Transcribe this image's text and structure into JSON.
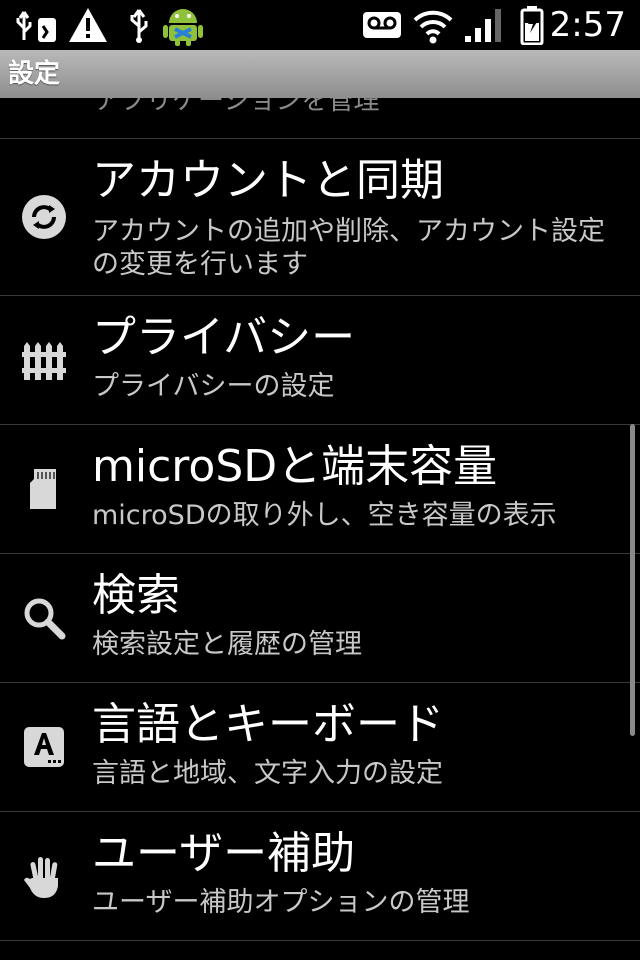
{
  "status_bar": {
    "icons": [
      "usb-debug-icon",
      "warning-icon",
      "usb-icon",
      "android-icon",
      "voicemail-icon",
      "wifi-icon",
      "signal-icon",
      "battery-charging-icon"
    ],
    "time": "2:57"
  },
  "title_bar": {
    "title": "設定"
  },
  "list": {
    "partial_item": "アプリケーションを管理",
    "items": [
      {
        "title": "アカウントと同期",
        "subtitle": "アカウントの追加や削除、アカウント設定の変更を行います",
        "icon": "sync-icon"
      },
      {
        "title": "プライバシー",
        "subtitle": "プライバシーの設定",
        "icon": "fence-icon"
      },
      {
        "title": "microSDと端末容量",
        "subtitle": "microSDの取り外し、空き容量の表示",
        "icon": "sd-card-icon"
      },
      {
        "title": "検索",
        "subtitle": "検索設定と履歴の管理",
        "icon": "search-icon"
      },
      {
        "title": "言語とキーボード",
        "subtitle": "言語と地域、文字入力の設定",
        "icon": "keyboard-language-icon"
      },
      {
        "title": "ユーザー補助",
        "subtitle": "ユーザー補助オプションの管理",
        "icon": "hand-icon"
      }
    ]
  }
}
